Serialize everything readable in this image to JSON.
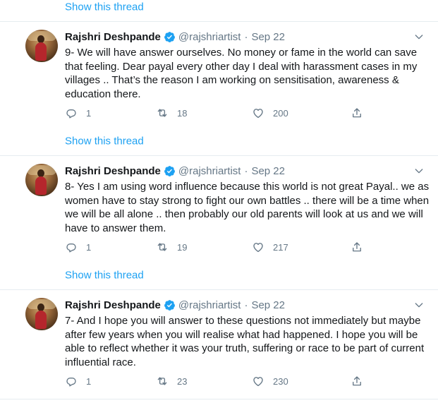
{
  "show_thread_label": "Show this thread",
  "tweets": [
    {
      "author": "Rajshri Deshpande",
      "handle": "@rajshriartist",
      "separator": "·",
      "date": "Sep 22",
      "text": "9- We will have answer ourselves. No money or fame in the world can save that feeling. Dear payal every other day I deal with harassment cases in my villages .. That’s the reason I am working on sensitisation, awareness & education there.",
      "replies": "1",
      "retweets": "18",
      "likes": "200"
    },
    {
      "author": "Rajshri Deshpande",
      "handle": "@rajshriartist",
      "separator": "·",
      "date": "Sep 22",
      "text": "8- Yes I am using word influence because this world is not great Payal.. we as women have to stay strong to fight our own battles .. there will be a time when we will be all alone .. then probably our old parents will look at us and we will have to answer them.",
      "replies": "1",
      "retweets": "19",
      "likes": "217"
    },
    {
      "author": "Rajshri Deshpande",
      "handle": "@rajshriartist",
      "separator": "·",
      "date": "Sep 22",
      "text": "7- And I hope you will answer to these questions not immediately but maybe after few years when you will realise what had happened. I hope you will be able to reflect whether it was your truth, suffering or race to be part of current influential race.",
      "replies": "1",
      "retweets": "23",
      "likes": "230"
    }
  ],
  "colors": {
    "link": "#1da1f2",
    "secondary_text": "#657786",
    "divider": "#e6ecf0",
    "verified": "#1da1f2"
  },
  "icons": [
    "verified-badge-icon",
    "chevron-down-icon",
    "reply-icon",
    "retweet-icon",
    "like-icon",
    "share-icon"
  ]
}
